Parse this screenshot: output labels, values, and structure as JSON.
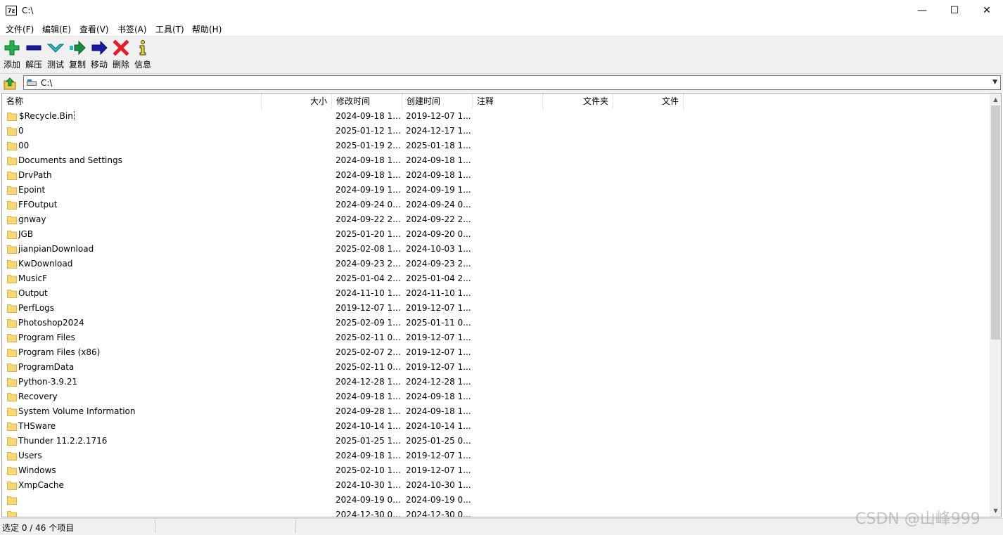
{
  "window": {
    "title": "C:\\",
    "app_icon_text": "7z",
    "minimize": "—",
    "maximize": "☐",
    "close": "✕"
  },
  "menu": [
    "文件(F)",
    "编辑(E)",
    "查看(V)",
    "书签(A)",
    "工具(T)",
    "帮助(H)"
  ],
  "toolbar": [
    {
      "label": "添加",
      "icon": "add-icon"
    },
    {
      "label": "解压",
      "icon": "extract-icon"
    },
    {
      "label": "测试",
      "icon": "test-icon"
    },
    {
      "label": "复制",
      "icon": "copy-icon"
    },
    {
      "label": "移动",
      "icon": "move-icon"
    },
    {
      "label": "删除",
      "icon": "delete-icon"
    },
    {
      "label": "信息",
      "icon": "info-icon"
    }
  ],
  "address": {
    "path": "C:\\"
  },
  "columns": {
    "name": "名称",
    "size": "大小",
    "modified": "修改时间",
    "created": "创建时间",
    "comment": "注释",
    "folders": "文件夹",
    "files": "文件"
  },
  "rows": [
    {
      "name": "$Recycle.Bin",
      "modified": "2024-09-18 1...",
      "created": "2019-12-07 1..."
    },
    {
      "name": "0",
      "modified": "2025-01-12 1...",
      "created": "2024-12-17 1..."
    },
    {
      "name": "00",
      "modified": "2025-01-19 2...",
      "created": "2025-01-18 1..."
    },
    {
      "name": "Documents and Settings",
      "modified": "2024-09-18 1...",
      "created": "2024-09-18 1..."
    },
    {
      "name": "DrvPath",
      "modified": "2024-09-18 1...",
      "created": "2024-09-18 1..."
    },
    {
      "name": "Epoint",
      "modified": "2024-09-19 1...",
      "created": "2024-09-19 1..."
    },
    {
      "name": "FFOutput",
      "modified": "2024-09-24 0...",
      "created": "2024-09-24 0..."
    },
    {
      "name": "gnway",
      "modified": "2024-09-22 2...",
      "created": "2024-09-22 2..."
    },
    {
      "name": "JGB",
      "modified": "2025-01-20 1...",
      "created": "2024-09-20 0..."
    },
    {
      "name": "jianpianDownload",
      "modified": "2025-02-08 1...",
      "created": "2024-10-03 1..."
    },
    {
      "name": "KwDownload",
      "modified": "2024-09-23 2...",
      "created": "2024-09-23 2..."
    },
    {
      "name": "MusicF",
      "modified": "2025-01-04 2...",
      "created": "2025-01-04 2..."
    },
    {
      "name": "Output",
      "modified": "2024-11-10 1...",
      "created": "2024-11-10 1..."
    },
    {
      "name": "PerfLogs",
      "modified": "2019-12-07 1...",
      "created": "2019-12-07 1..."
    },
    {
      "name": "Photoshop2024",
      "modified": "2025-02-09 1...",
      "created": "2025-01-11 0..."
    },
    {
      "name": "Program Files",
      "modified": "2025-02-11 0...",
      "created": "2019-12-07 1..."
    },
    {
      "name": "Program Files (x86)",
      "modified": "2025-02-07 2...",
      "created": "2019-12-07 1..."
    },
    {
      "name": "ProgramData",
      "modified": "2025-02-11 0...",
      "created": "2019-12-07 1..."
    },
    {
      "name": "Python-3.9.21",
      "modified": "2024-12-28 1...",
      "created": "2024-12-28 1..."
    },
    {
      "name": "Recovery",
      "modified": "2024-09-18 1...",
      "created": "2024-09-18 1..."
    },
    {
      "name": "System Volume Information",
      "modified": "2024-09-28 1...",
      "created": "2024-09-18 1..."
    },
    {
      "name": "THSware",
      "modified": "2024-10-14 1...",
      "created": "2024-10-14 1..."
    },
    {
      "name": "Thunder 11.2.2.1716",
      "modified": "2025-01-25 1...",
      "created": "2025-01-25 0..."
    },
    {
      "name": "Users",
      "modified": "2024-09-18 1...",
      "created": "2019-12-07 1..."
    },
    {
      "name": "Windows",
      "modified": "2025-02-10 1...",
      "created": "2019-12-07 1..."
    },
    {
      "name": "XmpCache",
      "modified": "2024-10-30 1...",
      "created": "2024-10-30 1..."
    },
    {
      "name": "",
      "modified": "2024-09-19 0...",
      "created": "2024-09-19 0..."
    },
    {
      "name": "",
      "modified": "2024-12-30 0...",
      "created": "2024-12-30 0..."
    }
  ],
  "status": {
    "selection": "选定 0 / 46 个项目"
  },
  "watermark": "CSDN @山峰999",
  "colors": {
    "folder": "#f8d775",
    "add": "#22b14c",
    "extract": "#1a1aa6",
    "test": "#2cb5c7",
    "delete": "#e51c23",
    "info": "#f2d80e"
  }
}
